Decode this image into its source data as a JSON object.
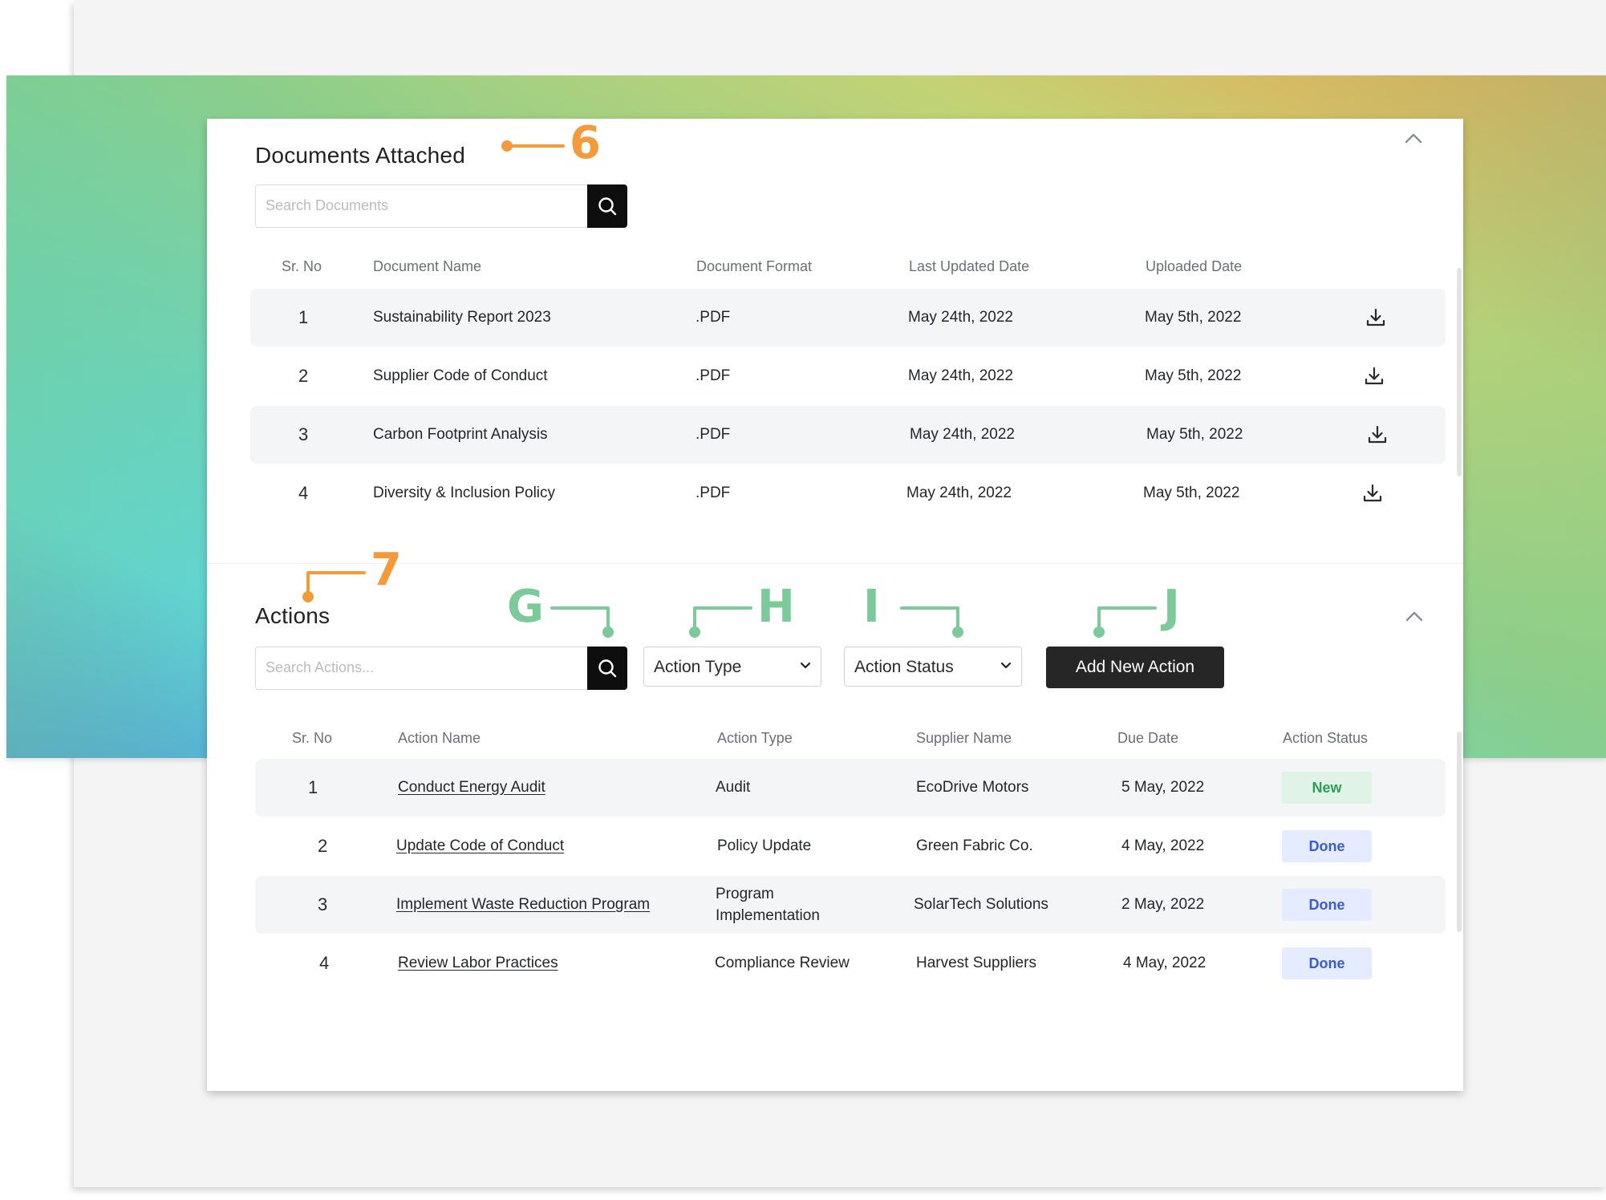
{
  "documents": {
    "title": "Documents Attached",
    "search_placeholder": "Search Documents",
    "headers": [
      "Sr. No",
      "Document Name",
      "Document Format",
      "Last Updated Date",
      "Uploaded Date"
    ],
    "rows": [
      {
        "sr": "1",
        "name": "Sustainability Report 2023",
        "format": ".PDF",
        "updated": "May 24th, 2022",
        "uploaded": "May 5th, 2022"
      },
      {
        "sr": "2",
        "name": "Supplier Code of Conduct",
        "format": ".PDF",
        "updated": "May 24th, 2022",
        "uploaded": "May 5th, 2022"
      },
      {
        "sr": "3",
        "name": "Carbon Footprint Analysis",
        "format": ".PDF",
        "updated": "May 24th, 2022",
        "uploaded": "May 5th, 2022"
      },
      {
        "sr": "4",
        "name": "Diversity & Inclusion Policy",
        "format": ".PDF",
        "updated": "May 24th, 2022",
        "uploaded": "May 5th, 2022"
      }
    ]
  },
  "actions": {
    "title": "Actions",
    "search_placeholder": "Search Actions...",
    "action_type_label": "Action Type",
    "action_status_label": "Action Status",
    "add_button_label": "Add New Action",
    "headers": [
      "Sr. No",
      "Action Name",
      "Action Type",
      "Supplier Name",
      "Due Date",
      "Action Status"
    ],
    "rows": [
      {
        "sr": "1",
        "name": "Conduct Energy Audit",
        "type": "Audit",
        "supplier": "EcoDrive Motors",
        "due": "5 May, 2022",
        "status": "New"
      },
      {
        "sr": "2",
        "name": "Update Code of Conduct",
        "type": "Policy Update",
        "supplier": "Green Fabric Co.",
        "due": "4 May, 2022",
        "status": "Done"
      },
      {
        "sr": "3",
        "name": "Implement Waste Reduction Program",
        "type": "Program Implementation",
        "supplier": "SolarTech Solutions",
        "due": "2 May, 2022",
        "status": "Done"
      },
      {
        "sr": "4",
        "name": "Review Labor Practices",
        "type": "Compliance Review",
        "supplier": "Harvest Suppliers",
        "due": "4 May, 2022",
        "status": "Done"
      }
    ]
  },
  "callouts": {
    "documents_marker": "6",
    "actions_marker": "7",
    "search_marker": "G",
    "type_marker": "H",
    "status_marker": "I",
    "add_marker": "J"
  },
  "icons": [
    "search-icon",
    "download-icon",
    "chevron-up-icon",
    "chevron-down-icon"
  ],
  "colors": {
    "callout_number": "#f39a3b",
    "callout_letter": "#7cc99a",
    "badge_new_bg": "#dff3e6",
    "badge_new_text": "#2e9e5b",
    "badge_done_bg": "#e6ecff",
    "badge_done_text": "#3a5bd6",
    "primary_button": "#262626"
  }
}
